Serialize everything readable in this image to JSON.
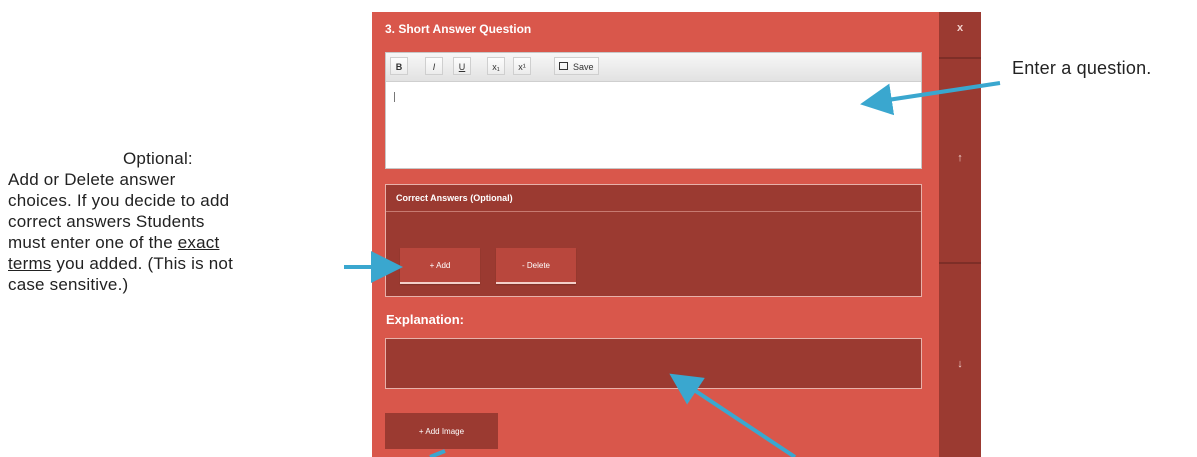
{
  "annotations": {
    "left_heading": "Optional:",
    "left_line1": "Add or Delete answer",
    "left_line2": "choices. If you decide to add",
    "left_line3": "correct answers Students",
    "left_line4_pre": "must enter one of the ",
    "left_line4_link": "exact",
    "left_line5_link": "terms",
    "left_line5_post": " you added. (This is not",
    "left_line6": "case sensitive.)",
    "right_note": "Enter a question."
  },
  "panel": {
    "title": "3. Short Answer Question"
  },
  "side_controls": {
    "close": "x",
    "up": "↑",
    "down": "↓"
  },
  "toolbar": {
    "bold": "B",
    "italic": "I",
    "underline": "U",
    "subscript": "x₁",
    "superscript": "x¹",
    "save": "Save"
  },
  "answers": {
    "title": "Correct Answers (Optional)",
    "add_label": "+ Add",
    "delete_label": "- Delete"
  },
  "explanation": {
    "label": "Explanation:"
  },
  "add_image_label": "+ Add Image",
  "colors": {
    "panel": "#d9574b",
    "dark_panel": "#9b3a31",
    "arrow": "#3aa7cf"
  },
  "icons": {
    "save": "floppy-disk-icon",
    "arrow": "pointer-arrow-icon"
  }
}
